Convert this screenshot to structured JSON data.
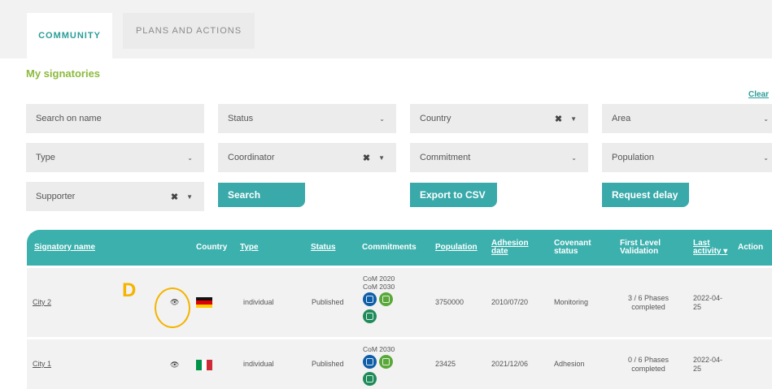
{
  "tabs": [
    {
      "label": "COMMUNITY",
      "active": true
    },
    {
      "label": "PLANS AND ACTIONS",
      "active": false
    }
  ],
  "section_title": "My signatories",
  "clear_link": "Clear",
  "filters": {
    "search": "Search on name",
    "status": "Status",
    "country": "Country",
    "area": "Area",
    "type": "Type",
    "coordinator": "Coordinator",
    "commitment": "Commitment",
    "population": "Population",
    "supporter": "Supporter"
  },
  "buttons": {
    "search": "Search",
    "export": "Export to CSV",
    "request_delay": "Request delay"
  },
  "table": {
    "headers": {
      "signatory_name": "Signatory name",
      "country": "Country",
      "type": "Type",
      "status": "Status",
      "commitments": "Commitments",
      "population": "Population",
      "adhesion_date_1": "Adhesion",
      "adhesion_date_2": "date",
      "covenant_1": "Covenant",
      "covenant_2": "status",
      "flv_1": "First Level",
      "flv_2": "Validation",
      "last_activity_1": "Last",
      "last_activity_2": "activity ▾",
      "actions": "Action"
    },
    "rows": [
      {
        "name": "City 2",
        "country_flag": "germany",
        "type": "individual",
        "status": "Published",
        "commitments": [
          "CoM 2020",
          "CoM 2030"
        ],
        "population": "3750000",
        "adhesion_date": "2010/07/20",
        "covenant_status": "Monitoring",
        "flv_1": "3 / 6 Phases",
        "flv_2": "completed",
        "last_activity_1": "2022-04-",
        "last_activity_2": "25"
      },
      {
        "name": "City 1",
        "country_flag": "italy",
        "type": "individual",
        "status": "Published",
        "commitments": [
          "CoM 2030"
        ],
        "population": "23425",
        "adhesion_date": "2021/12/06",
        "covenant_status": "Adhesion",
        "flv_1": "0 / 6 Phases",
        "flv_2": "completed",
        "last_activity_1": "2022-04-",
        "last_activity_2": "25"
      }
    ]
  },
  "annotation": {
    "label": "D",
    "color": "#f4b400"
  },
  "colors": {
    "teal": "#3bb0ad",
    "green_title": "#8dba3e",
    "annotation": "#f4b400"
  }
}
